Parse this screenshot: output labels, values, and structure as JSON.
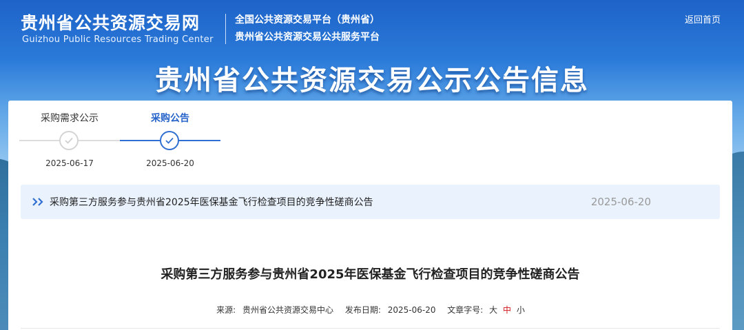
{
  "header": {
    "logo_cn": "贵州省公共资源交易网",
    "logo_en": "Guizhou Public Resources Trading Center",
    "platform_line1": "全国公共资源交易平台（贵州省）",
    "platform_line2": "贵州省公共资源交易公共服务平台",
    "home_link": "返回首页"
  },
  "banner": {
    "title": "贵州省公共资源交易公示公告信息"
  },
  "steps": [
    {
      "label": "采购需求公示",
      "date": "2025-06-17",
      "active": false
    },
    {
      "label": "采购公告",
      "date": "2025-06-20",
      "active": true
    }
  ],
  "notice": {
    "icon": "double-chevron-right-icon",
    "title": "采购第三方服务参与贵州省2025年医保基金飞行检查项目的竞争性磋商公告",
    "date": "2025-06-20"
  },
  "article": {
    "title": "采购第三方服务参与贵州省2025年医保基金飞行检查项目的竞争性磋商公告",
    "meta": {
      "source_label": "来源:",
      "source_value": "贵州省公共资源交易中心",
      "date_label": "发布日期:",
      "date_value": "2025-06-20",
      "font_size_label": "文章字号:",
      "size_large": "大",
      "size_medium": "中",
      "size_small": "小"
    }
  },
  "colors": {
    "accent": "#2f6fd1",
    "active_size": "#d0151a"
  }
}
